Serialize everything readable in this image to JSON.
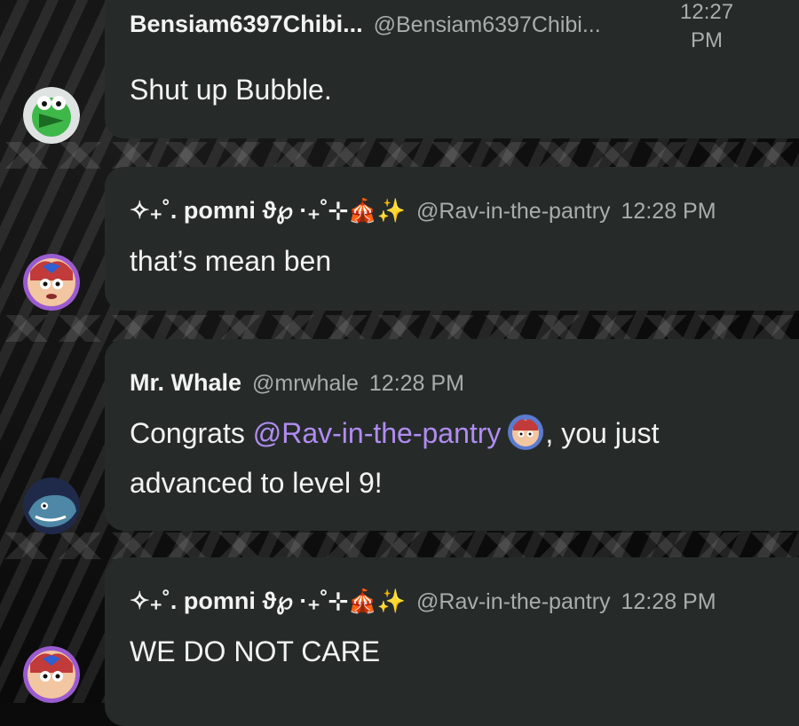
{
  "messages": [
    {
      "author": "Bensiam6397Chibi...",
      "handle": "@Bensiam6397Chibi...",
      "time_line1": "12:27",
      "time_line2": "PM",
      "text": "Shut up Bubble."
    },
    {
      "author": "✧₊˚. pomni ϑ℘ ·₊˚⊹",
      "author_emoji": "🎪✨",
      "handle": "@Rav-in-the-pantry",
      "time": "12:28 PM",
      "text": "that’s mean ben"
    },
    {
      "author": "Mr. Whale",
      "handle": "@mrwhale",
      "time": "12:28 PM",
      "text_before": "Congrats ",
      "mention": "@Rav-in-the-pantry",
      "text_after": ", you just",
      "text_line2": "advanced to level 9!"
    },
    {
      "author": "✧₊˚. pomni ϑ℘ ·₊˚⊹",
      "author_emoji": "🎪✨",
      "handle": "@Rav-in-the-pantry",
      "time": "12:28 PM",
      "text": "WE DO NOT CARE"
    }
  ],
  "colors": {
    "bubble": "#262b2a",
    "text": "#f2f3f2",
    "muted": "#a9aeab",
    "mention": "#b18cf2"
  },
  "icons": [
    "avatar-yoshi-icon",
    "avatar-pomni-icon",
    "avatar-whale-icon",
    "inline-avatar-pomni-icon"
  ]
}
